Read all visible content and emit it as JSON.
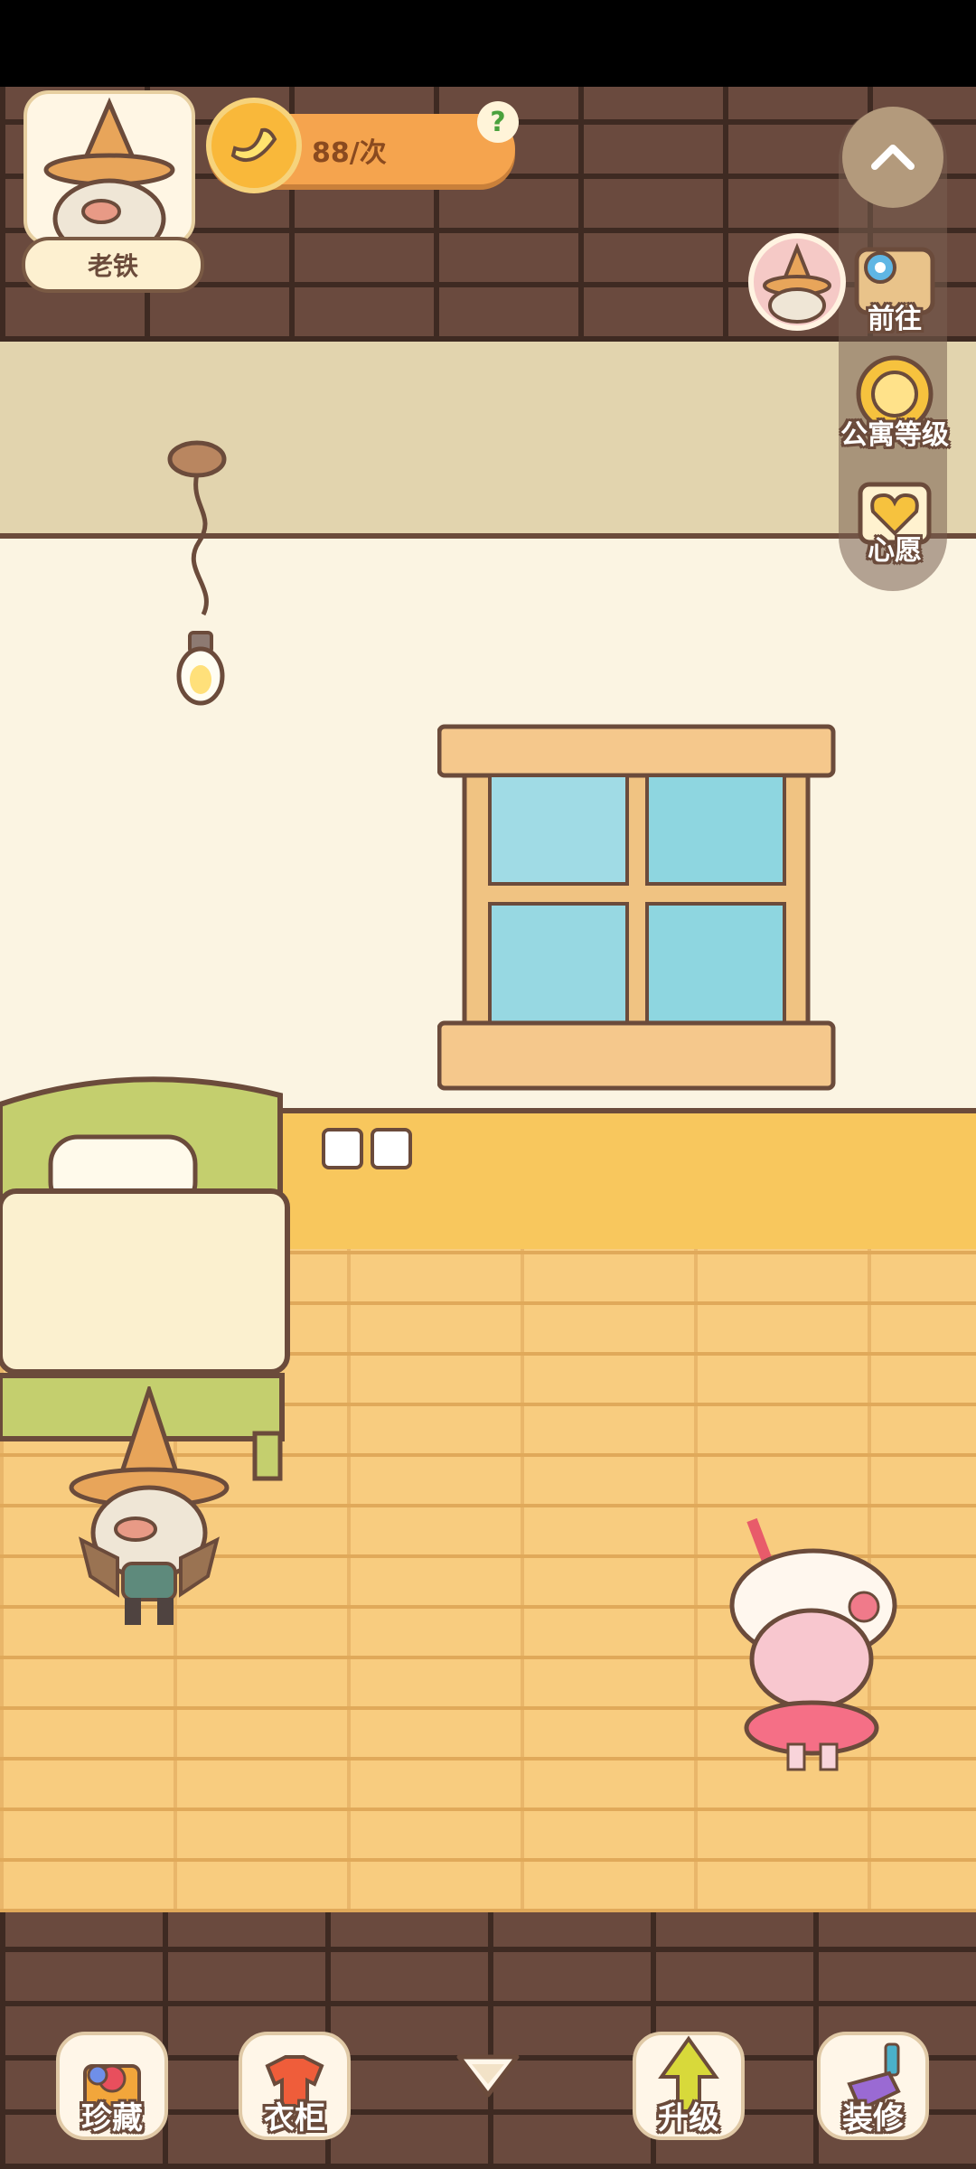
{
  "character": {
    "name": "老铁"
  },
  "cost": {
    "value": "88/次",
    "help": "?"
  },
  "side_menu": {
    "goto_label": "前往",
    "apartment_level_label": "公寓等级",
    "wish_label": "心愿"
  },
  "bottom_bar": {
    "collection_label": "珍藏",
    "wardrobe_label": "衣柜",
    "upgrade_label": "升级",
    "decorate_label": "装修"
  },
  "icons": {
    "coin": "banana-coin-icon",
    "collapse": "chevron-up-icon",
    "goto": "map-pin-icon",
    "level": "sun-cat-badge-icon",
    "wish": "heart-book-icon",
    "collection": "gem-box-icon",
    "wardrobe": "shirt-hanger-icon",
    "upgrade": "up-arrow-icon",
    "decorate": "paint-brush-icon",
    "expand_down": "triangle-down-icon"
  }
}
